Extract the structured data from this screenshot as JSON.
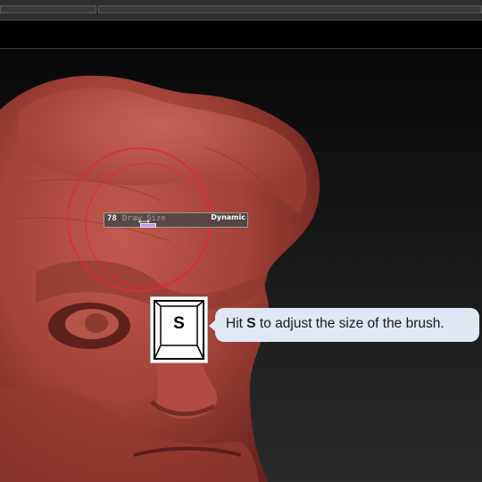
{
  "brush": {
    "size_value": "78",
    "size_label": "Draw Size",
    "dynamic_label": "Dynamic"
  },
  "key": {
    "letter": "S"
  },
  "hint": {
    "prefix": "Hit ",
    "key": "S",
    "suffix": " to adjust the size of the brush."
  },
  "colors": {
    "sculpt": "#a8463e",
    "brush_ring": "#e0283a",
    "hint_background": "#dfe8f4"
  }
}
